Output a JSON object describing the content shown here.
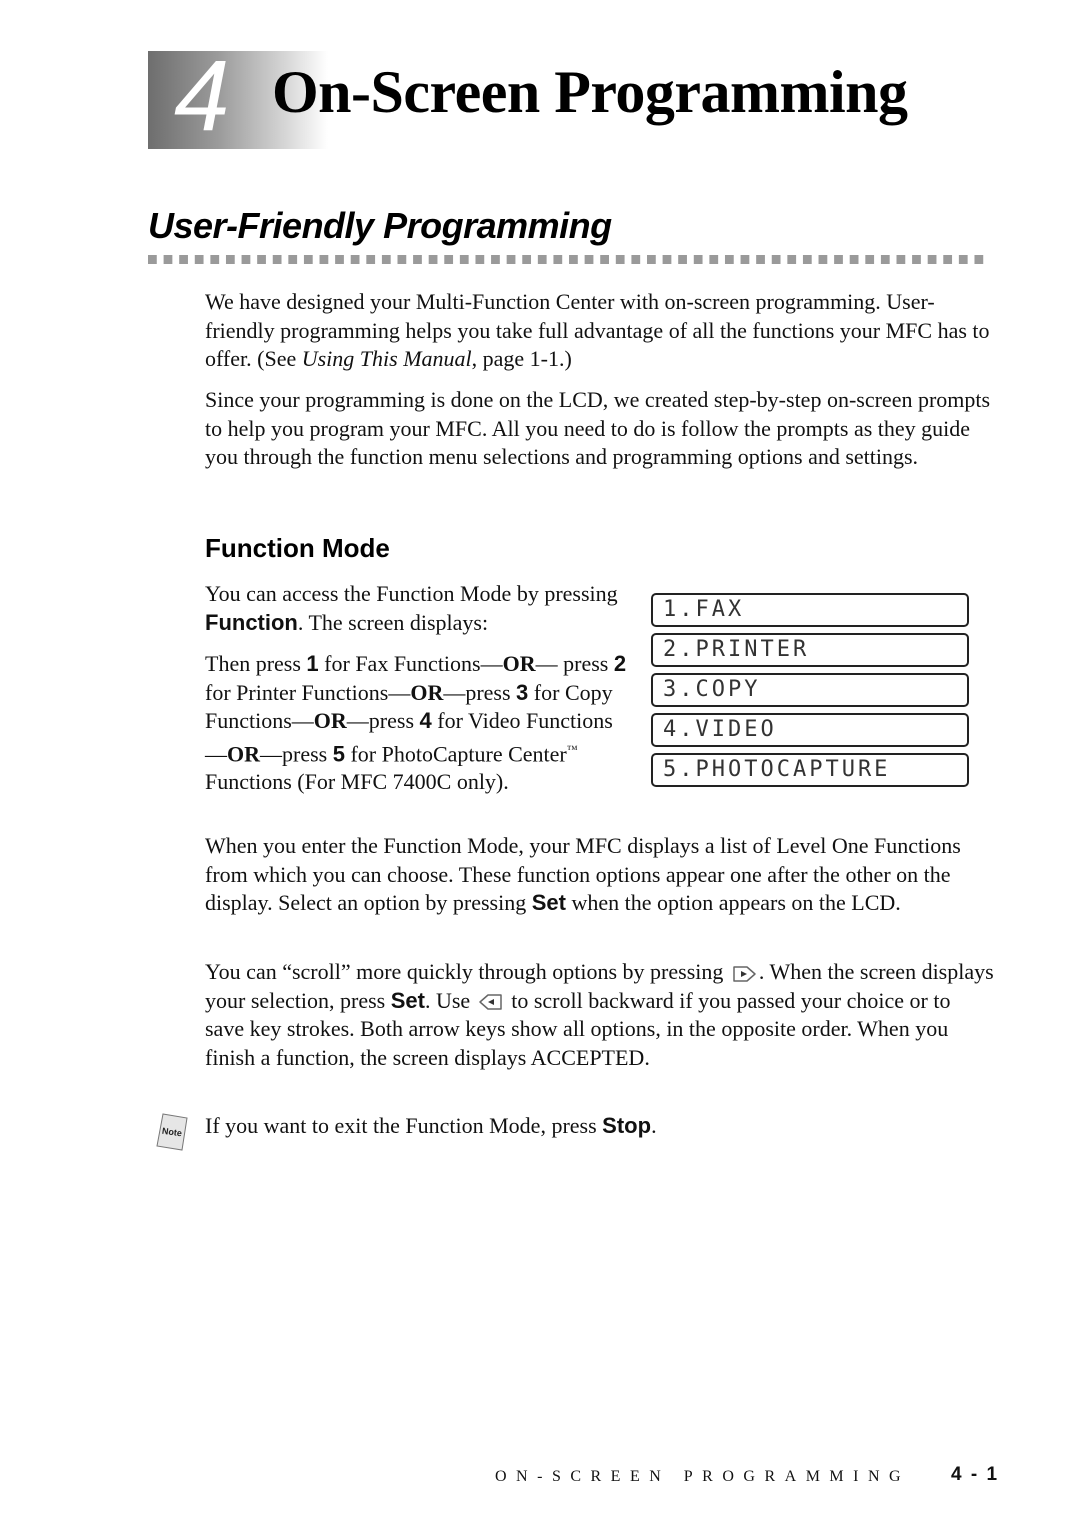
{
  "chapter": {
    "number": "4",
    "title": "On-Screen Programming"
  },
  "section": {
    "title": "User-Friendly Programming"
  },
  "intro": {
    "p1_a": "We have designed your Multi-Function Center with on-screen programming. User-friendly programming helps you take full advantage of all the functions your MFC has to offer. (See ",
    "p1_ref": "Using This Manual",
    "p1_b": ", page 1-1.)",
    "p2": "Since your programming is done on the LCD, we created step-by-step on-screen prompts to help you program your MFC. All you need to do is follow the prompts as they guide you through the function menu selections and programming options and settings."
  },
  "function_mode": {
    "title": "Function Mode",
    "access_a": "You can access the Function Mode by pressing ",
    "access_key": "Function",
    "access_b": ". The screen displays:",
    "press": {
      "t1": "Then press ",
      "k1": "1",
      "t2": " for Fax Functions—",
      "or1": "OR",
      "t3": "— press ",
      "k2": "2",
      "t4": " for Printer Functions—",
      "or2": "OR",
      "t5": "—press ",
      "k3": "3",
      "t6": " for Copy Functions—",
      "or3": "OR",
      "t7": "—press ",
      "k4": "4",
      "t8": " for Video Functions—",
      "or4": "OR",
      "t9": "—press ",
      "k5": "5",
      "t10": " for PhotoCapture Center",
      "tm": "™",
      "t11": " Functions (For MFC 7400C only)."
    },
    "lcd_items": [
      "1.FAX",
      "2.PRINTER",
      "3.COPY",
      "4.VIDEO",
      "5.PHOTOCAPTURE"
    ],
    "level_one_a": "When you enter the Function Mode, your MFC displays a list of Level One Functions from which you can choose. These function options appear one after the other on the display. Select an option by pressing ",
    "level_one_key": "Set",
    "level_one_b": " when the option appears on the LCD.",
    "scroll": {
      "a": "You can “scroll” more quickly through options by pressing ",
      "forward_icon": "right-arrow-key-icon",
      "b": ". When the screen displays your selection, press ",
      "key": "Set",
      "c": ".  Use ",
      "back_icon": "left-arrow-key-icon",
      "d": " to scroll backward if you passed your choice or to save key strokes. Both arrow keys show all options, in the opposite order. When you finish a function, the screen displays ACCEPTED."
    },
    "note": {
      "icon_label": "Note",
      "a": "If you want to exit the Function Mode, press ",
      "key": "Stop",
      "b": "."
    }
  },
  "footer": {
    "running_title": "ON-SCREEN PROGRAMMING",
    "page": "4 - 1"
  }
}
